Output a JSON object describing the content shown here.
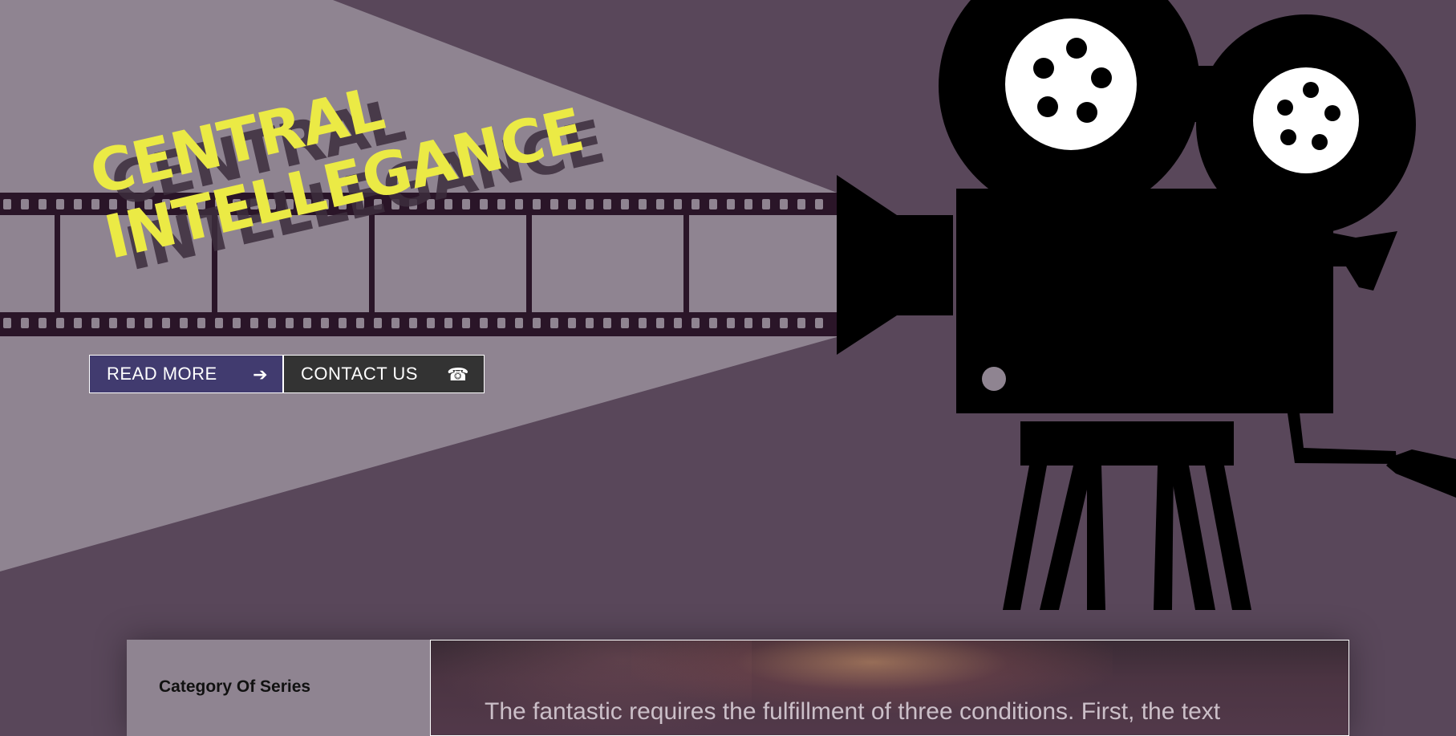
{
  "hero": {
    "title_line1": "CENTRAL",
    "title_line2": "INTELLEGANCE",
    "read_more_label": "READ MORE",
    "contact_label": "CONTACT US",
    "read_more_icon": "arrow-right-icon",
    "contact_icon": "phone-icon",
    "read_more_glyph": "➔",
    "contact_glyph": "☎"
  },
  "colors": {
    "background": "#59475a",
    "title": "#ebea45",
    "read_more_bg": "#413b6f",
    "contact_bg": "#333333",
    "film": "#2a1528",
    "beam": "#8f8491"
  },
  "section": {
    "sidebar_title": "Category Of Series",
    "feature_text": "The fantastic requires the fulfillment of three conditions. First, the text"
  }
}
